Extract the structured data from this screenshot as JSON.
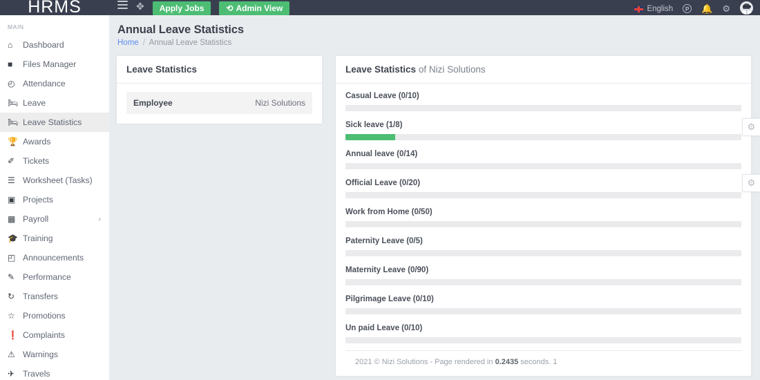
{
  "navbar": {
    "brand": "HRMS",
    "menu_toggle_icon": "hamburger-icon",
    "shuffle_icon": "shuffle-icon",
    "apply_jobs_label": "Apply Jobs",
    "admin_view_label": "Admin View",
    "admin_view_icon": "back-circle-icon",
    "language_label": "English",
    "language_flag_icon": "uk-flag-icon",
    "points_icon": "p-circle-icon",
    "bell_icon": "bell-icon",
    "settings_icon": "gear-icon",
    "avatar_icon": "user-avatar"
  },
  "sidebar": {
    "section_label": "MAIN",
    "items": [
      {
        "label": "Dashboard",
        "icon": "home-icon",
        "active": false,
        "caret": ""
      },
      {
        "label": "Files Manager",
        "icon": "file-icon",
        "active": false,
        "caret": ""
      },
      {
        "label": "Attendance",
        "icon": "clock-icon",
        "active": false,
        "caret": ""
      },
      {
        "label": "Leave",
        "icon": "bed-icon",
        "active": false,
        "caret": ""
      },
      {
        "label": "Leave Statistics",
        "icon": "bed-icon",
        "active": true,
        "caret": ""
      },
      {
        "label": "Awards",
        "icon": "trophy-icon",
        "active": false,
        "caret": ""
      },
      {
        "label": "Tickets",
        "icon": "ticket-icon",
        "active": false,
        "caret": ""
      },
      {
        "label": "Worksheet (Tasks)",
        "icon": "list-icon",
        "active": false,
        "caret": ""
      },
      {
        "label": "Projects",
        "icon": "projects-icon",
        "active": false,
        "caret": ""
      },
      {
        "label": "Payroll",
        "icon": "calculator-icon",
        "active": false,
        "caret": "›"
      },
      {
        "label": "Training",
        "icon": "graduation-icon",
        "active": false,
        "caret": ""
      },
      {
        "label": "Announcements",
        "icon": "announcement-icon",
        "active": false,
        "caret": ""
      },
      {
        "label": "Performance",
        "icon": "edit-square-icon",
        "active": false,
        "caret": ""
      },
      {
        "label": "Transfers",
        "icon": "refresh-icon",
        "active": false,
        "caret": ""
      },
      {
        "label": "Promotions",
        "icon": "star-icon",
        "active": false,
        "caret": ""
      },
      {
        "label": "Complaints",
        "icon": "exclamation-icon",
        "active": false,
        "caret": ""
      },
      {
        "label": "Warnings",
        "icon": "warning-icon",
        "active": false,
        "caret": ""
      },
      {
        "label": "Travels",
        "icon": "plane-icon",
        "active": false,
        "caret": ""
      }
    ]
  },
  "page": {
    "title": "Annual Leave Statistics",
    "breadcrumb_home": "Home",
    "breadcrumb_sep": "/",
    "breadcrumb_current": "Annual Leave Statistics"
  },
  "left_card": {
    "title": "Leave Statistics",
    "row_key": "Employee",
    "row_value": "Nizi Solutions"
  },
  "right_card": {
    "title_strong": "Leave Statistics",
    "title_muted": " of Nizi Solutions",
    "footer_pre": "2021 © Nizi Solutions - Page rendered in ",
    "footer_time": "0.2435",
    "footer_post": " seconds. 1",
    "gear_icon": "gear-icon"
  },
  "chart_data": {
    "type": "bar",
    "title": "Leave Statistics of Nizi Solutions",
    "xlabel": "",
    "ylabel": "",
    "categories": [
      "Casual Leave",
      "Sick leave",
      "Annual leave",
      "Official Leave",
      "Work from Home",
      "Paternity Leave",
      "Maternity Leave",
      "Pilgrimage Leave",
      "Un paid Leave"
    ],
    "values": [
      0,
      1,
      0,
      0,
      0,
      0,
      0,
      0,
      0
    ],
    "maximums": [
      10,
      8,
      14,
      20,
      50,
      5,
      90,
      10,
      10
    ],
    "percents": [
      0,
      12.5,
      0,
      0,
      0,
      0,
      0,
      0,
      0
    ],
    "labels": [
      "Casual Leave (0/10)",
      "Sick leave (1/8)",
      "Annual leave (0/14)",
      "Official Leave (0/20)",
      "Work from Home (0/50)",
      "Paternity Leave (0/5)",
      "Maternity Leave (0/90)",
      "Pilgrimage Leave (0/10)",
      "Un paid Leave (0/10)"
    ],
    "bar_color": "#4dbd74",
    "track_color": "#ebebed"
  }
}
